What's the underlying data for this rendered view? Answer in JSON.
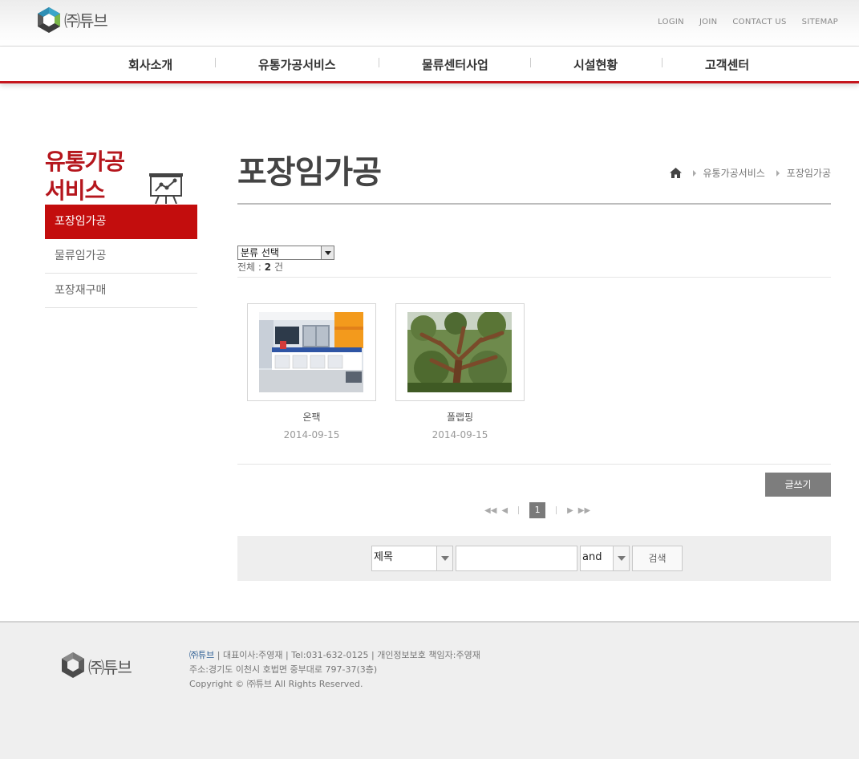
{
  "header": {
    "logo_text": "㈜튜브",
    "util": [
      "LOGIN",
      "JOIN",
      "CONTACT US",
      "SITEMAP"
    ]
  },
  "gnb": [
    "회사소개",
    "유통가공서비스",
    "물류센터사업",
    "시설현황",
    "고객센터"
  ],
  "side": {
    "title_line1": "유통가공",
    "title_line2": "서비스",
    "menu": [
      "포장임가공",
      "물류임가공",
      "포장재구매"
    ]
  },
  "main": {
    "title": "포장임가공",
    "breadcrumb": [
      "유통가공서비스",
      "포장임가공"
    ],
    "category_select": "분류 선택",
    "total_label": "전체 : ",
    "total_count": "2",
    "total_unit": " 건",
    "items": [
      {
        "name": "온팩",
        "date": "2014-09-15"
      },
      {
        "name": "폴랩핑",
        "date": "2014-09-15"
      }
    ],
    "write_button": "글쓰기",
    "pager": {
      "current": "1"
    },
    "search": {
      "field": "제목",
      "logic": "and",
      "button": "검색"
    }
  },
  "footer": {
    "logo_text": "㈜튜브",
    "line1_company": "㈜튜브",
    "line1_rest": " | 대표이사:주영재 | Tel:031-632-0125 | 개인정보보호 책임자:주영재",
    "line2": "주소:경기도 이천시 호법면 중부대로 797-37(3층)",
    "line3": "Copyright © ㈜튜브 All Rights Reserved."
  },
  "colors": {
    "accent": "#c30d0d",
    "title_red": "#b5161d",
    "button_gray": "#7d7d7d"
  }
}
